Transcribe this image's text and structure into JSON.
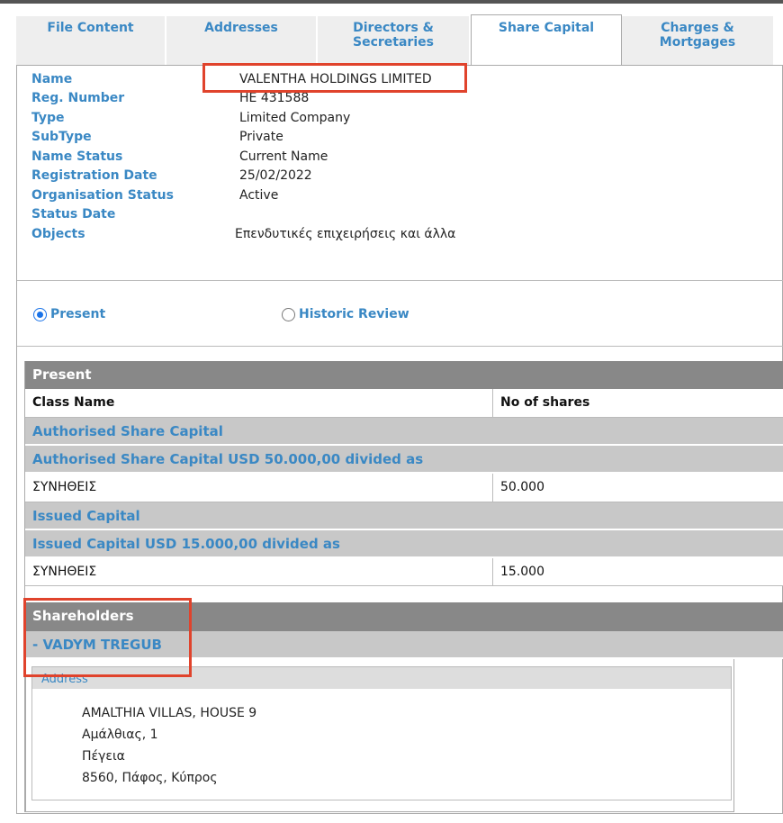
{
  "tabs": [
    {
      "label": "File Content"
    },
    {
      "label": "Addresses"
    },
    {
      "label": "Directors & Secretaries"
    },
    {
      "label": "Share Capital"
    },
    {
      "label": "Charges & Mortgages"
    }
  ],
  "company": {
    "rows": [
      {
        "label": "Name",
        "value": "VALENTHA HOLDINGS LIMITED"
      },
      {
        "label": "Reg. Number",
        "value": "HE 431588"
      },
      {
        "label": "Type",
        "value": "Limited Company"
      },
      {
        "label": "SubType",
        "value": "Private"
      },
      {
        "label": "Name Status",
        "value": "Current Name"
      },
      {
        "label": "Registration Date",
        "value": "25/02/2022"
      },
      {
        "label": "Organisation Status",
        "value": "Active"
      },
      {
        "label": "Status Date",
        "value": ""
      },
      {
        "label": "Objects",
        "value": "Επενδυτικές επιχειρήσεις και άλλα"
      }
    ]
  },
  "view": {
    "present_label": "Present",
    "historic_label": "Historic Review",
    "selected": "Present"
  },
  "share_capital": {
    "section_title": "Present",
    "col_class": "Class Name",
    "col_shares": "No of shares",
    "authorised_title": "Authorised Share Capital",
    "authorised_sub": "Authorised Share Capital USD 50.000,00 divided as",
    "authorised_row": {
      "class": "ΣΥΝΗΘΕΙΣ",
      "shares": "50.000"
    },
    "issued_title": "Issued Capital",
    "issued_sub": "Issued Capital USD 15.000,00 divided as",
    "issued_row": {
      "class": "ΣΥΝΗΘΕΙΣ",
      "shares": "15.000"
    }
  },
  "shareholders": {
    "title": "Shareholders",
    "name": "- VADYM TREGUB",
    "address_label": "Address",
    "address_lines": [
      "AMALTHIA VILLAS, HOUSE 9",
      "Αμάλθιας, 1",
      "Πέγεια",
      "8560, Πάφος, Κύπρος"
    ]
  },
  "colors": {
    "link_blue": "#3a88c4",
    "header_gray": "#888888",
    "row_gray": "#c8c8c8",
    "highlight_red": "#e0432c"
  }
}
